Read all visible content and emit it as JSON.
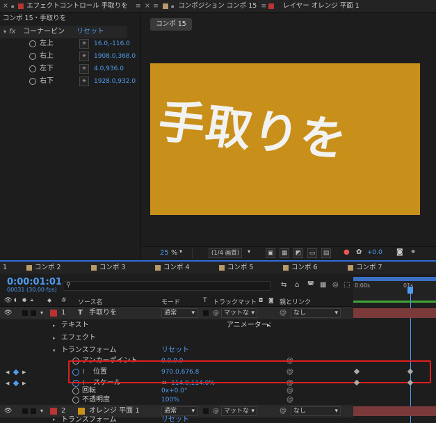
{
  "effect_panel": {
    "tab_label": "エフェクトコントロール 手取りを",
    "breadcrumb": "コンポ 15・手取りを",
    "effect_name": "コーナーピン",
    "reset": "リセット",
    "params": [
      {
        "name": "左上",
        "value": "16.0,-116.0"
      },
      {
        "name": "右上",
        "value": "1908.0,368.0"
      },
      {
        "name": "左下",
        "value": "4.0,936.0"
      },
      {
        "name": "右下",
        "value": "1928.0,932.0"
      }
    ]
  },
  "comp_panel": {
    "tab_label": "コンポジション コンポ 15",
    "layer_tab_label": "レイヤー オレンジ 平面 1",
    "comp_button": "コンポ 15",
    "preview_text": "手取りを",
    "zoom": "25",
    "zoom_unit": "%",
    "resolution": "(1/4 画質)",
    "exposure": "+0.0",
    "preview_bg": "#c8901a",
    "text_color": "#f2f2f2"
  },
  "timeline": {
    "tabs": [
      "1",
      "コンポ 2",
      "コンポ 3",
      "コンポ 4",
      "コンポ 5",
      "コンポ 6",
      "コンポ 7"
    ],
    "timecode": "0:00:01:01",
    "frame_info": "00031 (30.00 fps)",
    "search_placeholder": "",
    "columns": {
      "hash": "#",
      "source": "ソース名",
      "mode": "モード",
      "t": "T",
      "trackmatte": "トラックマット",
      "parent": "親とリンク"
    },
    "ruler": {
      "start": "0:00s",
      "mark": "01s"
    },
    "layer1": {
      "num": "1",
      "name": "手取りを",
      "mode": "通常",
      "matte": "マットな",
      "parent": "なし"
    },
    "text_group": "テキスト",
    "animator": "アニメーター：",
    "effects_group": "エフェクト",
    "transform_group": "トランスフォーム",
    "transform_reset": "リセット",
    "props": [
      {
        "name": "アンカーポイント",
        "value": "0.0,0.0"
      },
      {
        "name": "位置",
        "value": "970.0,676.8"
      },
      {
        "name": "スケール",
        "value": "114.0,114.0%"
      },
      {
        "name": "回転",
        "value": "0x+0.0°"
      },
      {
        "name": "不透明度",
        "value": "100%"
      }
    ],
    "layer2": {
      "num": "2",
      "name": "オレンジ 平面 1",
      "mode": "通常",
      "matte": "マットな",
      "parent": "なし"
    },
    "layer2_transform": "トランスフォーム",
    "layer2_reset": "リセット"
  }
}
